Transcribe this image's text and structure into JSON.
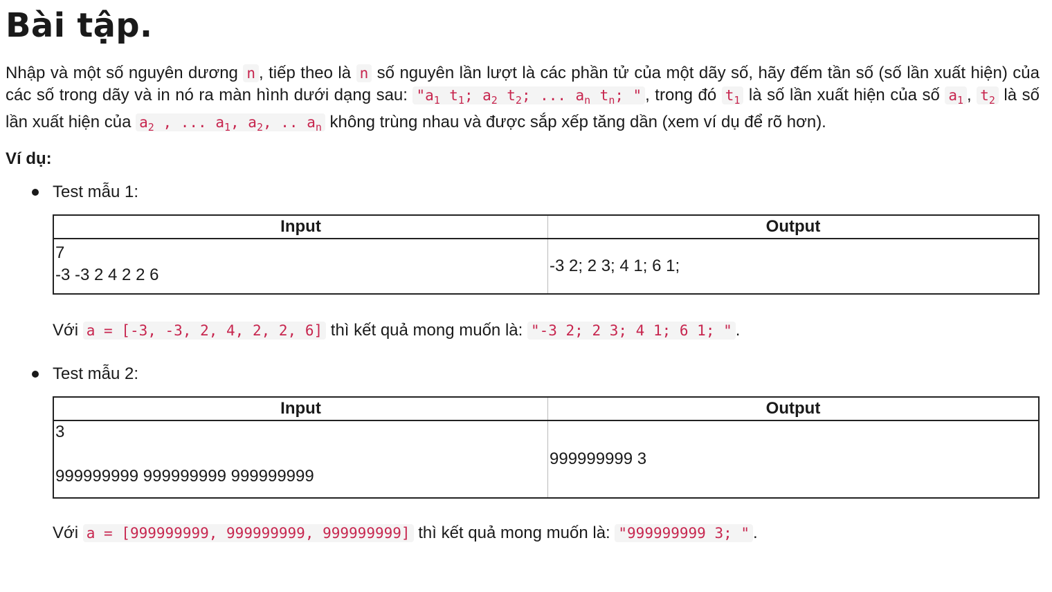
{
  "title": "Bài tập.",
  "intro": {
    "t1": "Nhập và một số nguyên dương ",
    "c1": "n",
    "t2": ", tiếp theo là ",
    "c2": "n",
    "t3": " số nguyên lần lượt là các phần tử của một dãy số, hãy đếm tần số (số lần xuất hiện) của các số trong dãy và in nó ra màn hình dưới dạng sau: ",
    "fmt": {
      "q1": "\"a",
      "s1": "1",
      "sp1": " t",
      "s2": "1",
      "sp2": "; a",
      "s3": "2",
      "sp3": " t",
      "s4": "2",
      "sp4": "; ... a",
      "s5": "n",
      "sp5": " t",
      "s6": "n",
      "sp6": "; \""
    },
    "t4": ", trong đó ",
    "c3": {
      "base": "t",
      "sub": "1"
    },
    "t5": " là số lần xuất hiện của số ",
    "c4": {
      "base": "a",
      "sub": "1"
    },
    "t6": ", ",
    "c5": {
      "base": "t",
      "sub": "2"
    },
    "t7": " là số lần xuất hiện của ",
    "c6": {
      "a": "a",
      "s1": "2",
      "b": " , ... a",
      "s2": "1",
      "c": ", a",
      "s3": "2",
      "d": ", .. a",
      "s4": "n"
    },
    "t8": " không trùng nhau và được sắp xếp tăng dần (xem ví dụ để rõ hơn)."
  },
  "example_heading": "Ví dụ:",
  "tests": [
    {
      "label": "Test mẫu 1:",
      "headers": [
        "Input",
        "Output"
      ],
      "input_lines": [
        "7",
        "-3 -3 2 4 2 2 6"
      ],
      "output": "-3 2; 2 3; 4 1; 6 1;",
      "result": {
        "t1": "Với ",
        "code1": "a = [-3, -3, 2, 4, 2, 2, 6]",
        "t2": " thì kết quả mong muốn là: ",
        "code2": "\"-3 2; 2 3; 4 1; 6 1; \"",
        "t3": "."
      }
    },
    {
      "label": "Test mẫu 2:",
      "headers": [
        "Input",
        "Output"
      ],
      "input_lines": [
        "3",
        "",
        "999999999 999999999 999999999"
      ],
      "output": "999999999 3",
      "result": {
        "t1": "Với ",
        "code1": "a = [999999999, 999999999, 999999999]",
        "t2": " thì kết quả mong muốn là: ",
        "code2": "\"999999999 3; \"",
        "t3": "."
      }
    }
  ]
}
